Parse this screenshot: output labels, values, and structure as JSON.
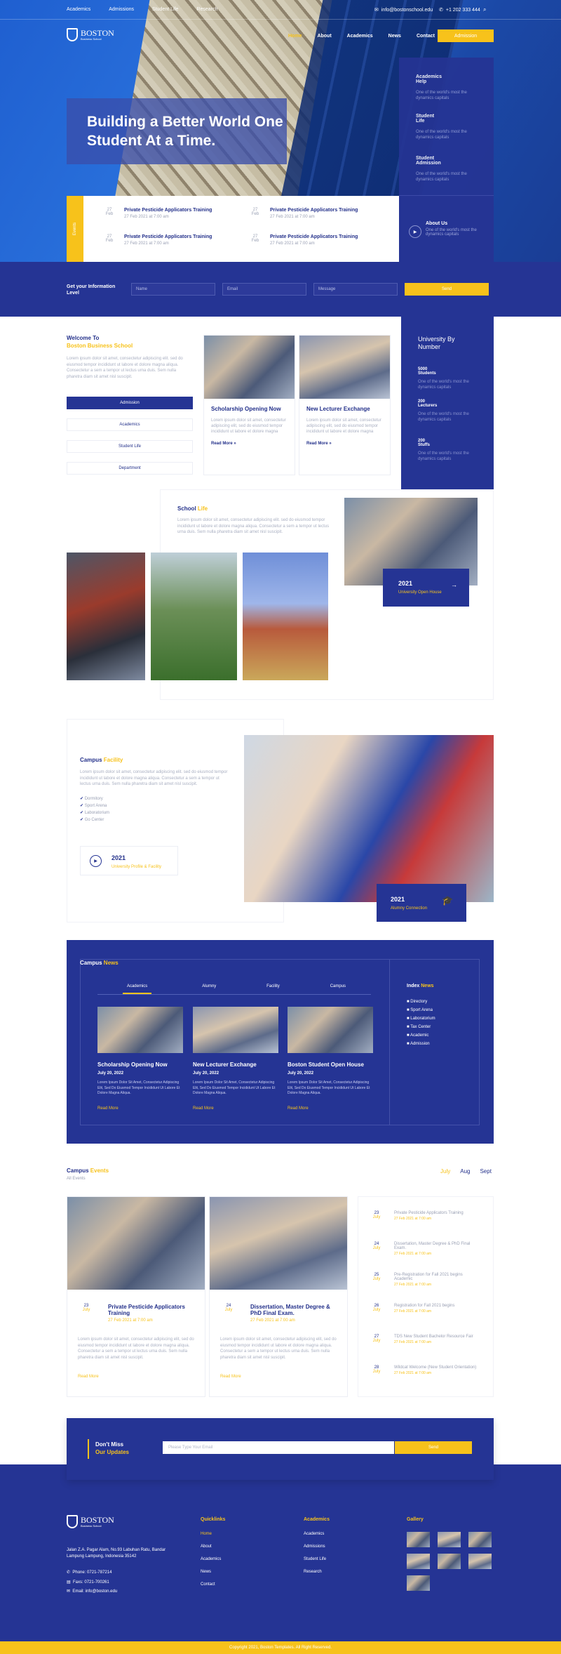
{
  "topbar": {
    "links": [
      "Academics",
      "Admissions",
      "Student Life",
      "Research"
    ],
    "email": "info@bostonschool.edu",
    "phone": "+1 202 333 444"
  },
  "brand": {
    "name": "BOSTON",
    "tagline": "Business School"
  },
  "nav": {
    "items": [
      "Home",
      "About",
      "Academics",
      "News",
      "Contact"
    ],
    "cta": "Admission"
  },
  "hero": {
    "title": "Building a Better World One Student At a Time.",
    "side_items": [
      {
        "title": "Academics Help",
        "desc": "One of the world's most the dynamics capitals"
      },
      {
        "title": "Student Life",
        "desc": "One of the world's most the dynamics capitals"
      },
      {
        "title": "Student Admission",
        "desc": "One of the world's most the dynamics capitals"
      }
    ],
    "events_tab": "Events",
    "events": [
      {
        "day": "27",
        "month": "Feb",
        "title": "Private Pesticide Applicators Training",
        "meta": "27 Feb 2021 at 7:00 am"
      },
      {
        "day": "27",
        "month": "Feb",
        "title": "Private Pesticide Applicators Training",
        "meta": "27 Feb 2021 at 7:00 am"
      },
      {
        "day": "27",
        "month": "Feb",
        "title": "Private Pesticide Applicators Training",
        "meta": "27 Feb 2021 at 7:00 am"
      },
      {
        "day": "27",
        "month": "Feb",
        "title": "Private Pesticide Applicators Training",
        "meta": "27 Feb 2021 at 7:00 am"
      }
    ],
    "about": {
      "title": "About Us",
      "desc": "One of the world's most the dynamics capitals"
    }
  },
  "info_bar": {
    "label": "Get your Information Level",
    "name_ph": "Name",
    "email_ph": "Email",
    "message_ph": "Message",
    "send": "Send"
  },
  "welcome": {
    "title": "Welcome To",
    "subtitle": "Boston Business School",
    "text": "Lorem ipsum dolor sit amet, consectetur adipiscing elit. sed do eiusmod tempor incididunt ut labore et dolore magna aliqua. Consectetur a sem a tempor ut lectus urna duis. Sem nulla pharetra diam sit amet nisl suscipit.",
    "buttons": [
      "Admission",
      "Academics",
      "Student Life",
      "Department"
    ]
  },
  "news_cards": [
    {
      "title": "Scholarship Opening Now",
      "text": "Lorem ipsum dolor sit amet, consectetur adipiscing elit, sed do eiusmod tempor incididunt ut labore et dolore magna",
      "link": "Read More »"
    },
    {
      "title": "New Lecturer Exchange",
      "text": "Lorem ipsum dolor sit amet, consectetur adipiscing elit, sed do eiusmod tempor incididunt ut labore et dolore magna",
      "link": "Read More »"
    }
  ],
  "by_number": {
    "title": "University By Number",
    "items": [
      {
        "value": "5000",
        "label": "Students",
        "desc": "One of the world's most the dynamics capitals"
      },
      {
        "value": "200",
        "label": "Lecturers",
        "desc": "One of the world's most the dynamics capitals"
      },
      {
        "value": "200",
        "label": "Stuffs",
        "desc": "One of the world's most the dynamics capitals"
      }
    ]
  },
  "school_life": {
    "title": "School",
    "title_accent": "Life",
    "text": "Lorem ipsum dolor sit amet, consectetur adipiscing elit. sed do eiusmod tempor incididunt ut labore et dolore magna aliqua. Consectetur a sem a tempor ut lectus urna duis. Sem nulla pharetra diam sit amet nisl suscipit.",
    "badge_year": "2021",
    "badge_text": "University Open House"
  },
  "campus_facility": {
    "title": "Campus",
    "title_accent": "Facility",
    "text": "Lorem ipsum dolor sit amet, consectetur adipiscing elit. sed do eiusmod tempor incididunt ut labore et dolore magna aliqua. Consectetur a sem a tempor ut lectus urna duis. Sem nulla pharetra diam sit amet nisl suscipit.",
    "list": [
      "Dormitory",
      "Sport Arena",
      "Laboratorium",
      "Go Center"
    ],
    "video_year": "2021",
    "video_text": "University Profile & Facility",
    "badge_year": "2021",
    "badge_text": "Alumny Connection"
  },
  "campus_news": {
    "title": "Campus",
    "title_accent": "News",
    "tabs": [
      "Academics",
      "Alumny",
      "Facility",
      "Campus"
    ],
    "cards": [
      {
        "title": "Scholarship Opening Now",
        "date": "July 20, 2022",
        "text": "Lorem Ipsum Dolor Sit Amet, Consectetur Adipiscing Elit, Sed Do Eiusmod Tempor Incididunt Ut Labore Et Dolore Magna Aliqua.",
        "link": "Read More"
      },
      {
        "title": "New Lecturer Exchange",
        "date": "July 20, 2022",
        "text": "Lorem Ipsum Dolor Sit Amet, Consectetur Adipiscing Elit, Sed Do Eiusmod Tempor Incididunt Ut Labore Et Dolore Magna Aliqua.",
        "link": "Read More"
      },
      {
        "title": "Boston Student Open House",
        "date": "July 20, 2022",
        "text": "Lorem Ipsum Dolor Sit Amet, Consectetur Adipiscing Elit, Sed Do Eiusmod Tempor Incididunt Ut Labore Et Dolore Magna Aliqua.",
        "link": "Read More"
      }
    ],
    "index_title": "Index",
    "index_accent": "News",
    "index_items": [
      "Directory",
      "Sport Arena",
      "Laboratorium",
      "Tax Center",
      "Academic",
      "Admission"
    ]
  },
  "campus_events": {
    "title": "Campus",
    "title_accent": "Events",
    "subtitle": "All Events",
    "months": [
      "July",
      "Aug",
      "Sept"
    ],
    "cards": [
      {
        "day": "23",
        "month": "July",
        "title": "Private Pesticide Applicators Training",
        "meta": "27 Feb 2021 at 7:00 am",
        "text": "Lorem ipsum dolor sit amet, consectetur adipiscing elit, sed do eiusmod tempor incididunt ut labore et dolore magna aliqua. Consectetur a sem a tempor ut lectus urna duis. Sem nulla pharetra diam sit amet nisl suscipit.",
        "link": "Read More"
      },
      {
        "day": "24",
        "month": "July",
        "title": "Dissertation, Master Degree & PhD Final Exam.",
        "meta": "27 Feb 2021 at 7:00 am",
        "text": "Lorem ipsum dolor sit amet, consectetur adipiscing elit, sed do eiusmod tempor incididunt ut labore et dolore magna aliqua. Consectetur a sem a tempor ut lectus urna duis. Sem nulla pharetra diam sit amet nisl suscipit.",
        "link": "Read More"
      }
    ],
    "list": [
      {
        "day": "23",
        "month": "July",
        "title": "Private Pesticide Applicators Training",
        "meta": "27 Feb 2021 at 7:00 am"
      },
      {
        "day": "24",
        "month": "July",
        "title": "Dissertation, Master Degree & PhD Final Exam.",
        "meta": "27 Feb 2021 at 7:00 am"
      },
      {
        "day": "25",
        "month": "July",
        "title": "Pre-Registration for Fall 2021 begins Academic",
        "meta": "27 Feb 2021 at 7:00 am"
      },
      {
        "day": "26",
        "month": "July",
        "title": "Registration for Fall 2021 begins",
        "meta": "27 Feb 2021 at 7:00 am"
      },
      {
        "day": "27",
        "month": "July",
        "title": "TDS New Student Bachelor Resource Fair",
        "meta": "27 Feb 2021 at 7:00 am"
      },
      {
        "day": "28",
        "month": "July",
        "title": "Wildcat Welcome (New Student Orientation)",
        "meta": "27 Feb 2021 at 7:00 am"
      }
    ]
  },
  "subscribe": {
    "title": "Don't Miss",
    "title_accent": "Our Updates",
    "placeholder": "Please Type Your Email",
    "button": "Send"
  },
  "footer": {
    "address": "Jalan Z.A. Pagar Alam, No.93 Labuhan Ratu, Bandar Lampung Lampung, Indonesia 35142",
    "phone": "Phone: 0721-787214",
    "fax": "Faxs: 0721-700261",
    "email": "Email: info@boston.edu",
    "quicklinks_title": "Quicklinks",
    "quicklinks": [
      "Home",
      "About",
      "Academics",
      "News",
      "Contact"
    ],
    "academics_title": "Academics",
    "academics": [
      "Academics",
      "Admissions",
      "Student Life",
      "Research"
    ],
    "gallery_title": "Gallery",
    "copyright": "Copyright 2021, Boston Templates. All Right Reserved."
  },
  "colors": {
    "navy": "#253494",
    "yellow": "#f7c21b"
  }
}
